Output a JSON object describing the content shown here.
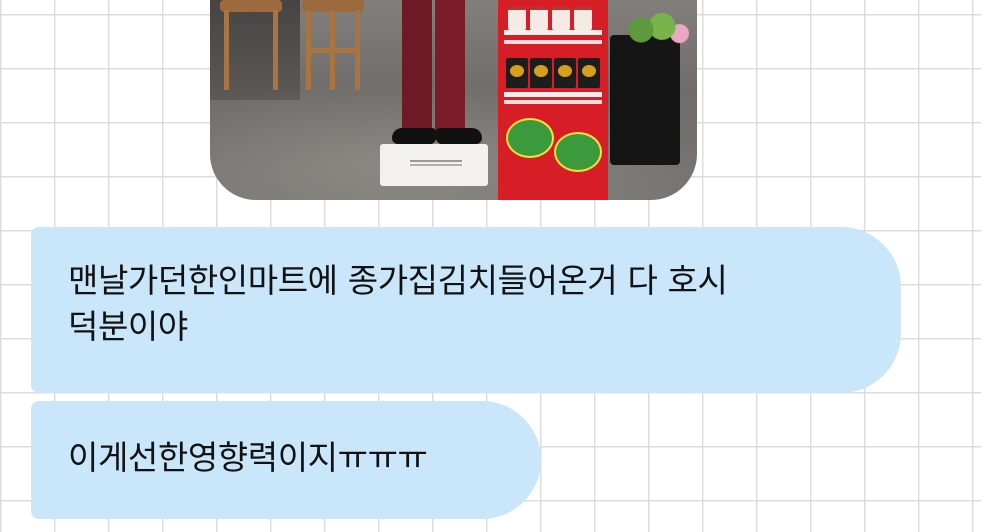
{
  "chat": {
    "photo": {
      "icon": "shared-photo"
    },
    "messages": [
      {
        "text": "맨날가던한인마트에 종가집김치들어온거 다 호시\n덕분이야"
      },
      {
        "text": "이게선한영향력이지ㅠㅠㅠ"
      }
    ]
  },
  "colors": {
    "bubble_background": "#c9e6fb",
    "grid_line": "#dcdcdc",
    "page_background": "#ffffff",
    "text": "#121212"
  }
}
